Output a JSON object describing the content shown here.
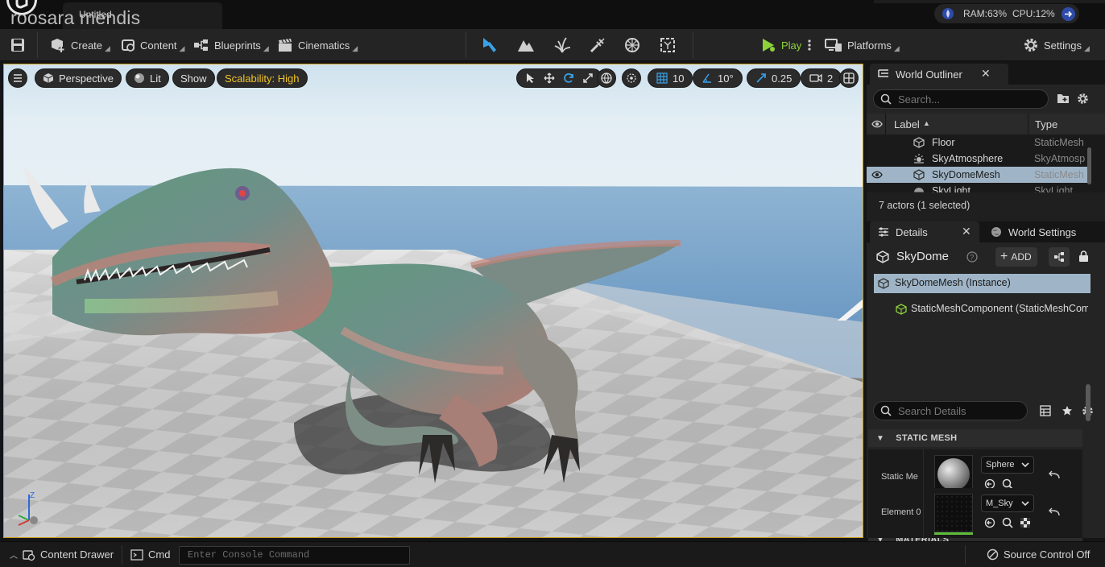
{
  "titlebar": {
    "document_tab": "Untitled",
    "watermark": "roosara mendis",
    "ram": "RAM:63%",
    "cpu": "CPU:12%"
  },
  "toolbar": {
    "create": "Create",
    "content": "Content",
    "blueprints": "Blueprints",
    "cinematics": "Cinematics",
    "play": "Play",
    "platforms": "Platforms",
    "settings": "Settings"
  },
  "viewport": {
    "perspective": "Perspective",
    "lit": "Lit",
    "show": "Show",
    "scalability": "Scalability: High",
    "grid_snap": "10",
    "rotation_snap": "10°",
    "scale_snap": "0.25",
    "camera_speed": "2",
    "axis_z": "Z"
  },
  "outliner": {
    "tab_title": "World Outliner",
    "search_placeholder": "Search...",
    "col_label": "Label",
    "col_type": "Type",
    "rows": [
      {
        "label": "Floor",
        "type": "StaticMesh",
        "icon": "cube-icon"
      },
      {
        "label": "SkyAtmosphere",
        "type": "SkyAtmosphere",
        "icon": "sky-atmosphere-icon"
      },
      {
        "label": "SkyDomeMesh",
        "type": "StaticMesh",
        "icon": "cube-icon"
      },
      {
        "label": "SkyLight",
        "type": "SkyLight",
        "icon": "skylight-icon"
      }
    ],
    "selected_row": 2,
    "footer": "7 actors (1 selected)"
  },
  "details": {
    "tab_title": "Details",
    "world_settings_tab": "World Settings",
    "actor_name": "SkyDome",
    "add_label": "ADD",
    "instance_label": "SkyDomeMesh (Instance)",
    "component_label": "StaticMeshComponent (StaticMeshCom",
    "search_placeholder": "Search Details",
    "static_mesh_section": "STATIC MESH",
    "static_mesh_prop": "Static Me",
    "static_mesh_value": "Sphere",
    "materials_section": "MATERIALS",
    "element_prop": "Element 0",
    "element_value": "M_Sky"
  },
  "statusbar": {
    "content_drawer": "Content Drawer",
    "cmd": "Cmd",
    "console_placeholder": "Enter Console Command",
    "source_control": "Source Control Off"
  },
  "colors": {
    "accent_play": "#8cd33a",
    "scalability": "#f0c426",
    "viewport_border": "#c79b1a",
    "selection": "#9fb5c7"
  }
}
